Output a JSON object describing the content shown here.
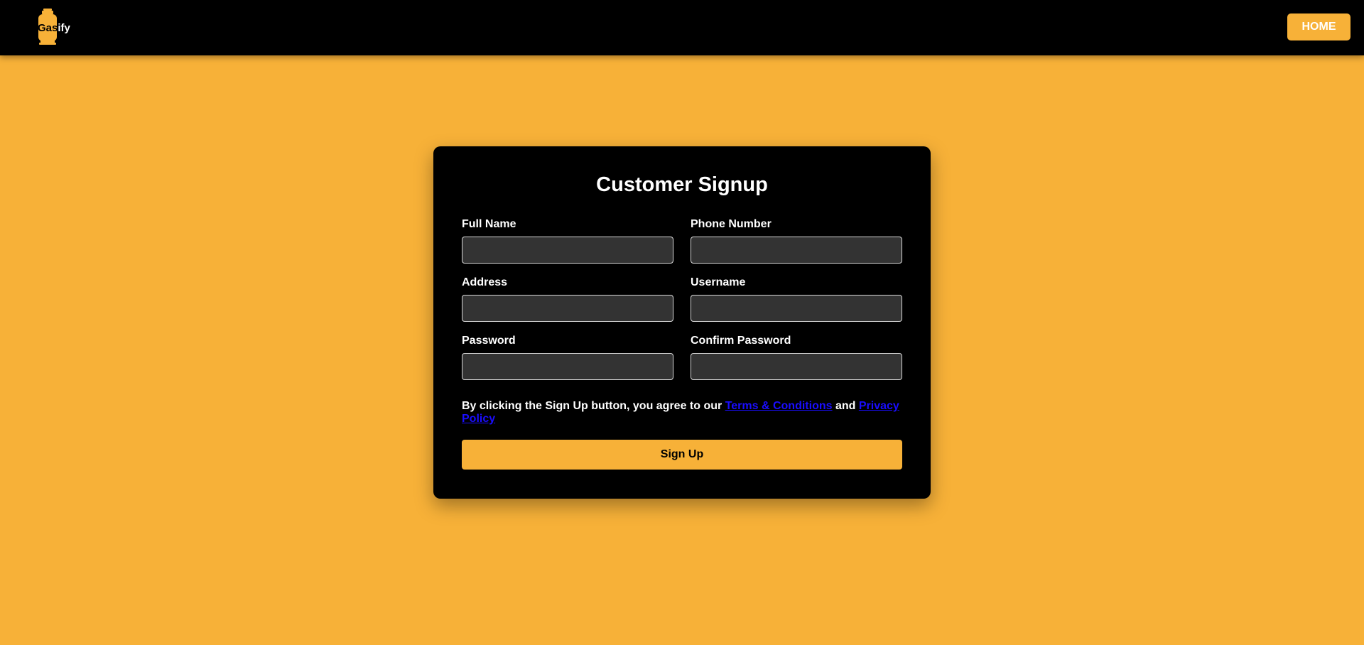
{
  "header": {
    "logo": {
      "text_part1": "Gas",
      "text_part2": "ify",
      "icon": "gas-cylinder-icon",
      "color": "#F7B138"
    },
    "home_label": "HOME"
  },
  "form": {
    "title": "Customer Signup",
    "fields": [
      {
        "label": "Full Name",
        "value": "",
        "placeholder": ""
      },
      {
        "label": "Phone Number",
        "value": "",
        "placeholder": ""
      },
      {
        "label": "Address",
        "value": "",
        "placeholder": ""
      },
      {
        "label": "Username",
        "value": "",
        "placeholder": ""
      },
      {
        "label": "Password",
        "value": "",
        "placeholder": ""
      },
      {
        "label": "Confirm Password",
        "value": "",
        "placeholder": ""
      }
    ],
    "agreement": {
      "prefix": "By clicking the Sign Up button, you agree to our ",
      "terms_link": "Terms & Conditions",
      "conjunction": " and ",
      "privacy_link": "Privacy Policy"
    },
    "submit_label": "Sign Up"
  },
  "colors": {
    "background": "#F7B138",
    "header": "#000000",
    "card": "#000000",
    "input_bg": "#333333",
    "accent": "#F7B138",
    "link": "#1a0dff"
  }
}
